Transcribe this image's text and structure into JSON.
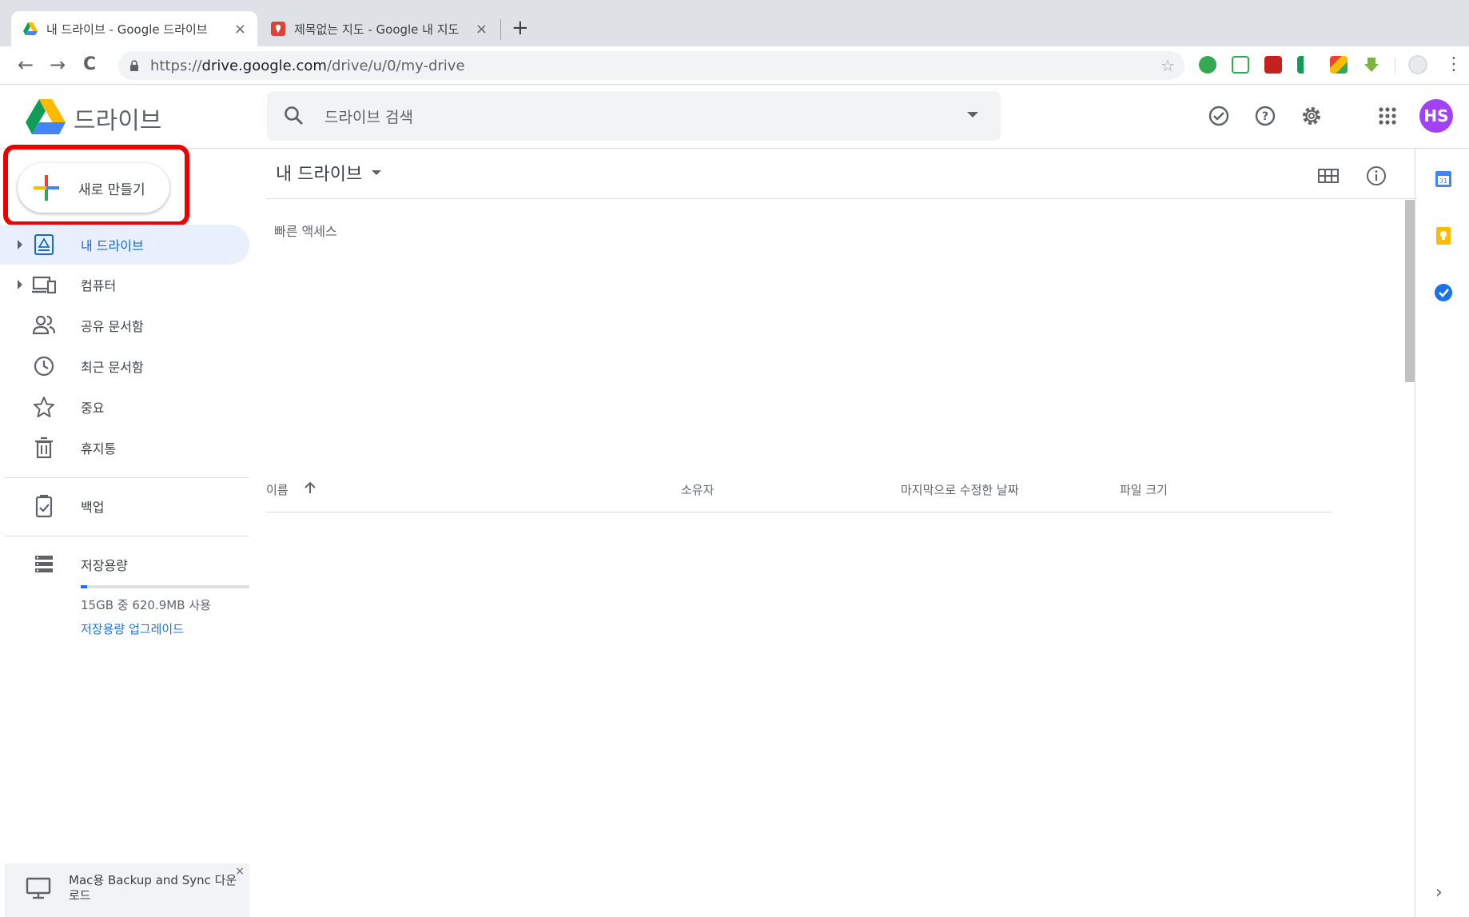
{
  "browser": {
    "tabs": [
      {
        "title": "내 드라이브 - Google 드라이브",
        "close": "×"
      },
      {
        "title": "제목없는 지도 - Google 내 지도",
        "close": "×"
      }
    ],
    "new_tab": "+",
    "back": "←",
    "forward": "→",
    "reload": "C",
    "url_scheme": "https://",
    "url_host": "drive.google.com",
    "url_path": "/drive/u/0/my-drive",
    "bookmark_star": "☆",
    "menu": "⋮"
  },
  "header": {
    "product": "드라이브",
    "search_placeholder": "드라이브 검색",
    "avatar_initials": "HS",
    "avatar_color": "#a142f4"
  },
  "sidebar": {
    "new_label": "새로 만들기",
    "items": [
      {
        "label": "내 드라이브",
        "icon": "my-drive-icon"
      },
      {
        "label": "컴퓨터",
        "icon": "computers-icon"
      },
      {
        "label": "공유 문서함",
        "icon": "shared-icon"
      },
      {
        "label": "최근 문서함",
        "icon": "clock-icon"
      },
      {
        "label": "중요",
        "icon": "star-icon"
      },
      {
        "label": "휴지통",
        "icon": "trash-icon"
      },
      {
        "label": "백업",
        "icon": "backup-icon"
      },
      {
        "label": "저장용량",
        "icon": "storage-icon"
      }
    ],
    "storage_text": "15GB 중 620.9MB 사용",
    "storage_used_fraction": 0.04,
    "storage_link": "저장용량 업그레이드",
    "backup_banner": "Mac용 Backup and Sync 다운로드",
    "backup_close": "×"
  },
  "main": {
    "title": "내 드라이브",
    "quick_access": "빠른 액세스",
    "columns": [
      "이름",
      "소유자",
      "마지막으로 수정한 날짜",
      "파일 크기"
    ]
  },
  "colors": {
    "accent": "#1a73e8",
    "active_bg": "#e8f0fe",
    "highlight": "#ee0000"
  }
}
